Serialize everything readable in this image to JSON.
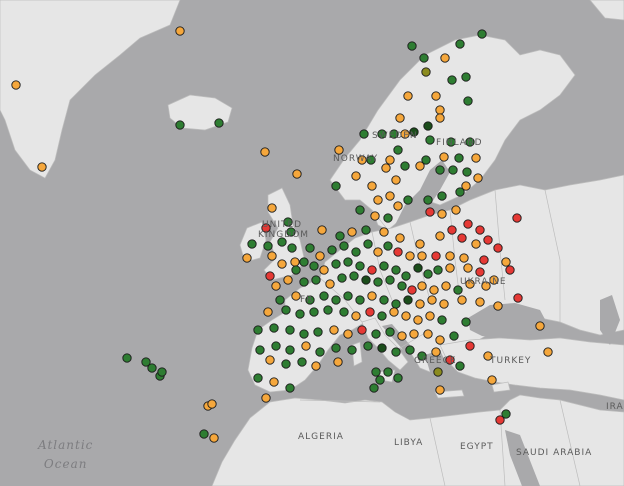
{
  "map": {
    "colors": {
      "water": "#a9a9ab",
      "land": "#e6e6e6",
      "border": "#bdbdbd",
      "marker_green": "#2e7d32",
      "marker_darkgreen": "#1b4d1b",
      "marker_orange": "#f5a73c",
      "marker_red": "#e53935",
      "marker_olive": "#8b8b1e",
      "marker_outline": "#1a1a1a"
    },
    "ocean_label": {
      "line1": "Atlantic",
      "line2": "Ocean"
    },
    "labels": {
      "norway": "NORWAY",
      "sweden": "SWEDEN",
      "finland": "FINLAND",
      "united": "UNITED",
      "kingdom": "KINGDOM",
      "ukraine": "UKRAINE",
      "france": "FR",
      "greece": "GREECE",
      "turkey": "TURKEY",
      "algeria": "ALGERIA",
      "libya": "LIBYA",
      "egypt": "EGYPT",
      "saudi": "SAUDI ARABIA",
      "iraq": "IRA"
    }
  }
}
